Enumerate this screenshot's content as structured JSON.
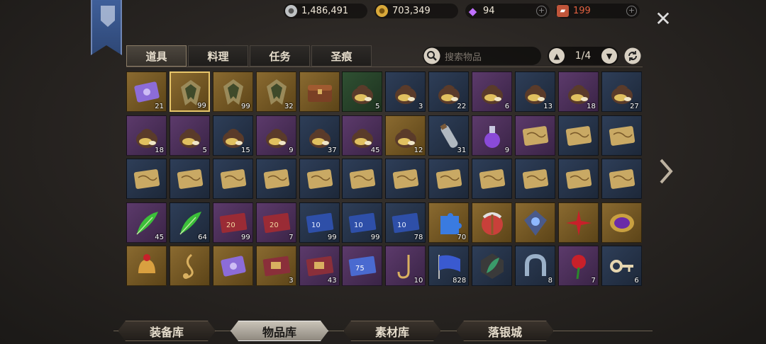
{
  "currency": {
    "silver": "1,486,491",
    "gold": "703,349",
    "gem": "94",
    "ticket": "199"
  },
  "tabs": [
    "道具",
    "料理",
    "任务",
    "圣痕"
  ],
  "search": {
    "placeholder": "搜索物品"
  },
  "pager": {
    "page": "1/4"
  },
  "colors": {
    "blue": "#2e3e58",
    "purple": "#5c3a6b",
    "gold": "#8a6a30",
    "green": "#2f5032",
    "selection": "#e8c66a"
  },
  "items": [
    {
      "icon": "ticket-icon",
      "bg": "gold",
      "count": "21"
    },
    {
      "icon": "emblem-icon",
      "bg": "gold",
      "count": "99",
      "selected": true
    },
    {
      "icon": "emblem-icon",
      "bg": "gold",
      "count": "99"
    },
    {
      "icon": "emblem-icon",
      "bg": "gold",
      "count": "32"
    },
    {
      "icon": "chest-icon",
      "bg": "gold",
      "count": ""
    },
    {
      "icon": "money-bag-icon",
      "bg": "green",
      "count": "5"
    },
    {
      "icon": "money-bag-icon",
      "bg": "blue",
      "count": "3"
    },
    {
      "icon": "money-bag-icon",
      "bg": "blue",
      "count": "22"
    },
    {
      "icon": "money-bag-icon",
      "bg": "purple",
      "count": "6"
    },
    {
      "icon": "money-bag-icon",
      "bg": "blue",
      "count": "13"
    },
    {
      "icon": "money-bag-icon",
      "bg": "purple",
      "count": "18"
    },
    {
      "icon": "money-bag-icon",
      "bg": "blue",
      "count": "27"
    },
    {
      "icon": "money-bag-icon",
      "bg": "purple",
      "count": "18"
    },
    {
      "icon": "money-bag-icon",
      "bg": "purple",
      "count": "5"
    },
    {
      "icon": "money-bag-icon",
      "bg": "blue",
      "count": "15"
    },
    {
      "icon": "money-bag-icon",
      "bg": "purple",
      "count": "9"
    },
    {
      "icon": "money-bag-icon",
      "bg": "blue",
      "count": "37"
    },
    {
      "icon": "money-bag-icon",
      "bg": "purple",
      "count": "45"
    },
    {
      "icon": "money-bag-icon",
      "bg": "gold",
      "count": "12"
    },
    {
      "icon": "bottle-icon",
      "bg": "blue",
      "count": "31"
    },
    {
      "icon": "potion-icon",
      "bg": "purple",
      "count": "9"
    },
    {
      "icon": "map-scroll-icon",
      "bg": "purple",
      "count": ""
    },
    {
      "icon": "map-scroll-icon",
      "bg": "blue",
      "count": ""
    },
    {
      "icon": "map-scroll-icon",
      "bg": "blue",
      "count": ""
    },
    {
      "icon": "map-scroll-icon",
      "bg": "blue",
      "count": ""
    },
    {
      "icon": "map-scroll-icon",
      "bg": "blue",
      "count": ""
    },
    {
      "icon": "map-scroll-icon",
      "bg": "blue",
      "count": ""
    },
    {
      "icon": "map-scroll-icon",
      "bg": "blue",
      "count": ""
    },
    {
      "icon": "map-scroll-icon",
      "bg": "blue",
      "count": ""
    },
    {
      "icon": "map-scroll-icon",
      "bg": "blue",
      "count": ""
    },
    {
      "icon": "map-scroll-icon",
      "bg": "blue",
      "count": ""
    },
    {
      "icon": "map-scroll-icon",
      "bg": "blue",
      "count": ""
    },
    {
      "icon": "map-scroll-icon",
      "bg": "blue",
      "count": ""
    },
    {
      "icon": "map-scroll-icon",
      "bg": "blue",
      "count": ""
    },
    {
      "icon": "map-scroll-icon",
      "bg": "blue",
      "count": ""
    },
    {
      "icon": "map-scroll-icon",
      "bg": "blue",
      "count": ""
    },
    {
      "icon": "green-feather-icon",
      "bg": "purple",
      "count": "45"
    },
    {
      "icon": "green-feather-icon",
      "bg": "blue",
      "count": "64"
    },
    {
      "icon": "coupon-20-icon",
      "bg": "purple",
      "count": "99"
    },
    {
      "icon": "coupon-20-icon",
      "bg": "purple",
      "count": "7"
    },
    {
      "icon": "coupon-10-icon",
      "bg": "blue",
      "count": "99"
    },
    {
      "icon": "coupon-10-icon",
      "bg": "blue",
      "count": "99"
    },
    {
      "icon": "coupon-10-icon",
      "bg": "blue",
      "count": "78"
    },
    {
      "icon": "puzzle-icon",
      "bg": "gold",
      "count": "70"
    },
    {
      "icon": "pickaxe-icon",
      "bg": "gold",
      "count": ""
    },
    {
      "icon": "crest-icon",
      "bg": "gold",
      "count": ""
    },
    {
      "icon": "red-star-icon",
      "bg": "gold",
      "count": ""
    },
    {
      "icon": "amulet-icon",
      "bg": "gold",
      "count": ""
    },
    {
      "icon": "bell-icon",
      "bg": "gold",
      "count": ""
    },
    {
      "icon": "music-note-icon",
      "bg": "gold",
      "count": ""
    },
    {
      "icon": "ticket-icon",
      "bg": "gold",
      "count": ""
    },
    {
      "icon": "coupon-icon",
      "bg": "gold",
      "count": "3"
    },
    {
      "icon": "coupon-icon",
      "bg": "purple",
      "count": "43"
    },
    {
      "icon": "coupon-75-icon",
      "bg": "purple",
      "count": ""
    },
    {
      "icon": "hook-icon",
      "bg": "purple",
      "count": "10"
    },
    {
      "icon": "flag-icon",
      "bg": "blue",
      "count": "828"
    },
    {
      "icon": "quill-icon",
      "bg": "blue",
      "count": ""
    },
    {
      "icon": "horseshoe-icon",
      "bg": "blue",
      "count": "8"
    },
    {
      "icon": "rose-icon",
      "bg": "purple",
      "count": "7"
    },
    {
      "icon": "key-icon",
      "bg": "blue",
      "count": "6"
    }
  ],
  "bottom_tabs": [
    "装备库",
    "物品库",
    "素材库",
    "落银城"
  ]
}
